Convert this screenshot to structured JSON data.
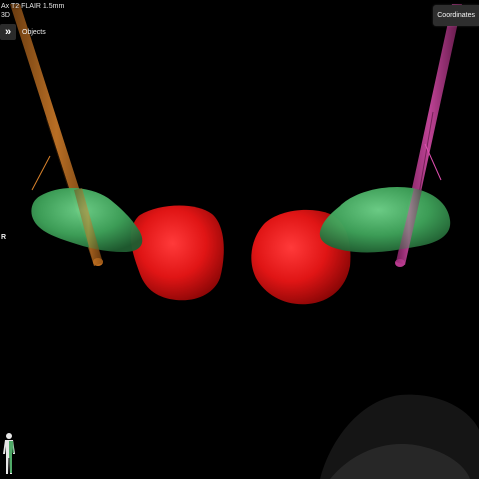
{
  "viewer": {
    "series_title": "Ax T2 FLAIR 1.5mm",
    "mode": "3D",
    "objects_label": "Objects",
    "objects_chevron": "»",
    "coordinates_label": "Coordinates",
    "orientation_right": "R"
  },
  "icons": {
    "objects_toggle": "double-chevron-right-icon",
    "orientation": "body-figure-icon"
  },
  "colors": {
    "background": "#000000",
    "lead_left": "#d9822b",
    "lead_right": "#d63fa3",
    "structure_green": "#3fa35a",
    "structure_red": "#e01818",
    "overlay_text": "#e8e8e8",
    "button_bg": "#2e2e2e"
  }
}
